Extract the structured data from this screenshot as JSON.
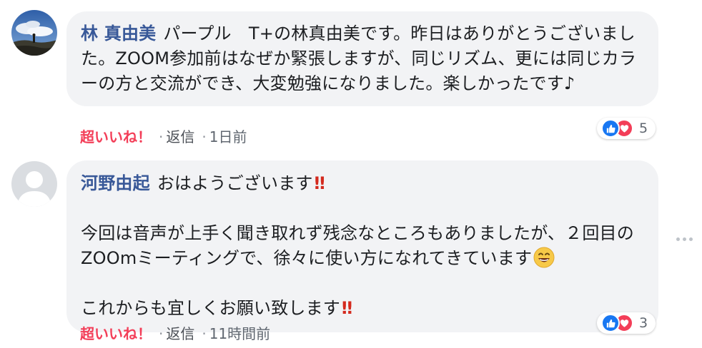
{
  "comments": [
    {
      "author": "林 真由美",
      "paragraphs": [
        "パープル　T+の林真由美です。昨日はありがとうございました。ZOOM参加前はなぜか緊張しますが、同じリズム、更には同じカラーの方と交流ができ、大変勉強になりました。楽しかったです♪"
      ],
      "like_label": "超いいね！",
      "reply_label": "返信",
      "time": "1日前",
      "reaction_count": "5",
      "avatar": "landscape-photo"
    },
    {
      "author": "河野由起",
      "intro": "おはようございます",
      "intro_emoji": "‼",
      "line2": "今回は音声が上手く聞き取れず残念なところもありましたが、２回目のZOOmミーティングで、徐々に使い方になれてきています",
      "line2_emoji": "smiling-face-icon",
      "line3": "これからも宜しくお願い致します",
      "line3_emoji": "‼",
      "like_label": "超いいね！",
      "reply_label": "返信",
      "time": "11時間前",
      "reaction_count": "3",
      "avatar": "default-silhouette"
    }
  ],
  "separator": "·",
  "icons": {
    "like": "thumbs-up-icon",
    "love": "heart-icon",
    "more": "more-options-icon"
  },
  "colors": {
    "author": "#385898",
    "like_text": "#f33e58",
    "like_reaction": "#1877f2",
    "love_reaction": "#f33e58",
    "bubble": "#f2f3f5"
  }
}
